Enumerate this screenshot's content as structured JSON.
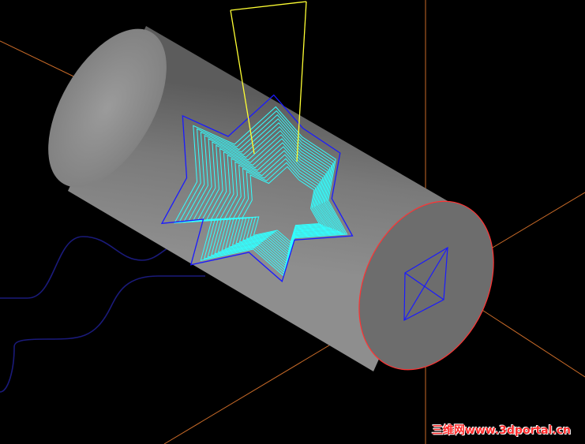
{
  "viewport": {
    "background": "#000000",
    "model": "cylinder-stock",
    "toolpath": "5-axis-star-pocket-toolpath",
    "tool": "tapered-cutter"
  },
  "colors": {
    "toolpath": "#33ffff",
    "toolpath_outline": "#1a1aff",
    "tool_outline": "#ffff33",
    "axes": "#c86a28",
    "end_face_edge": "#ff3333",
    "rotation_axis_frame": "#1a1aff",
    "stock_dark": "#3a3a3a",
    "stock_light": "#b4b4b4"
  },
  "watermark": {
    "text": "三维网www.3dportal.cn"
  }
}
